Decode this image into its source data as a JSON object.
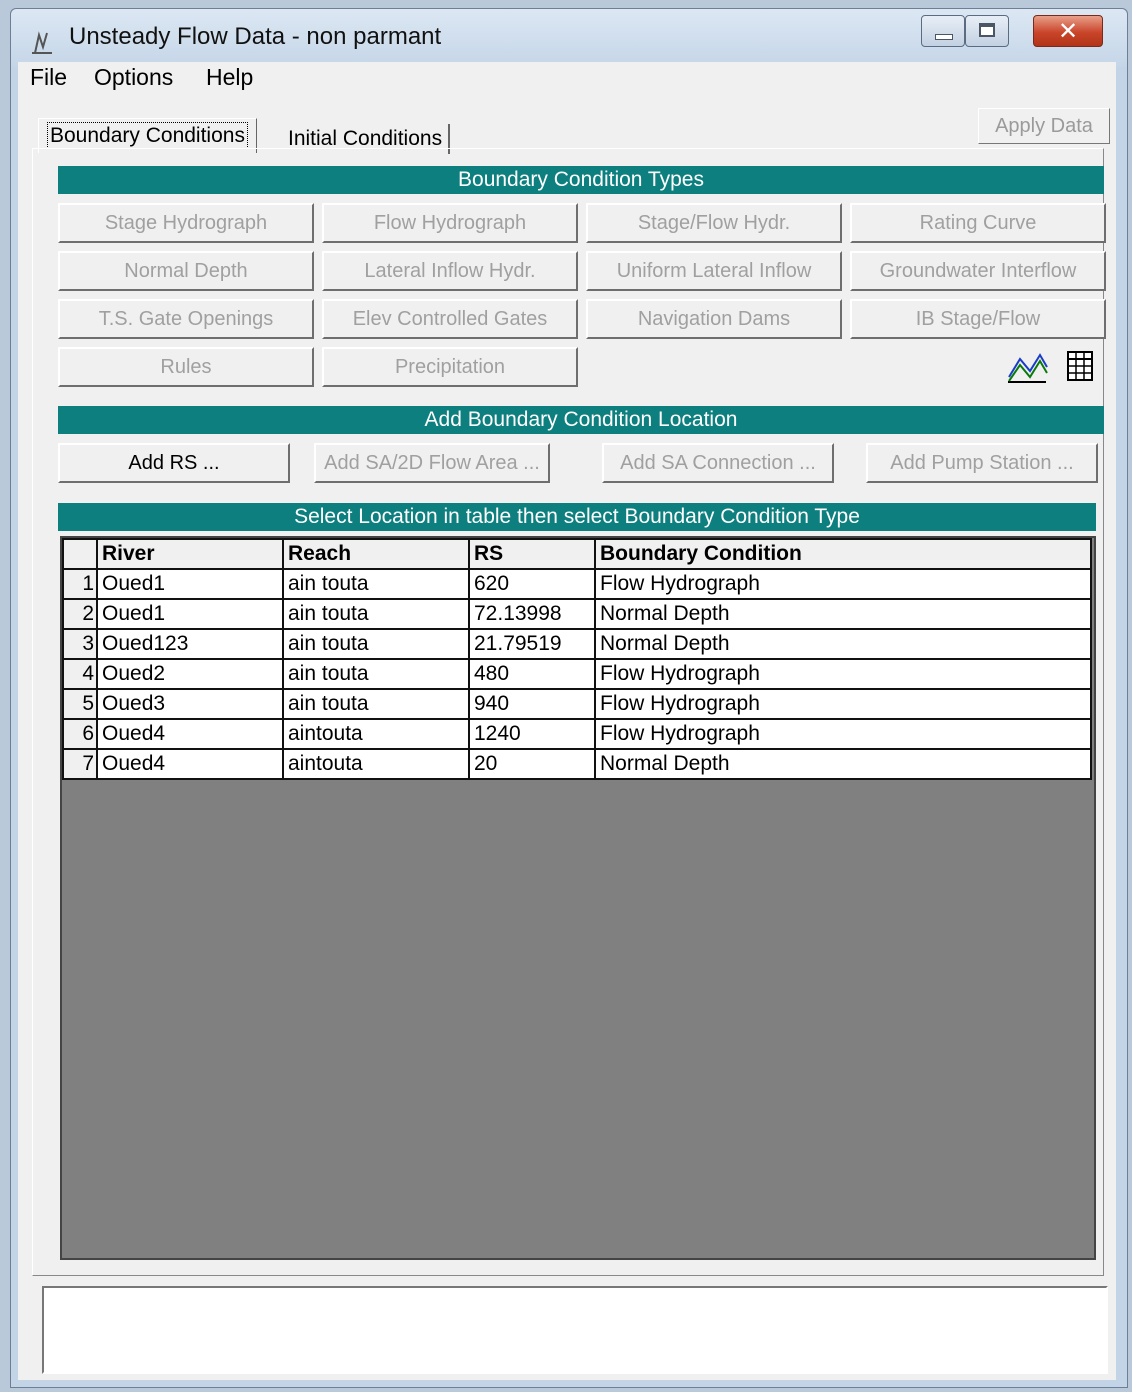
{
  "window": {
    "title": "Unsteady Flow Data - non parmant"
  },
  "menu": {
    "items": [
      "File",
      "Options",
      "Help"
    ]
  },
  "tabs": {
    "boundary": "Boundary Conditions",
    "initial": "Initial Conditions"
  },
  "apply_label": "Apply Data",
  "bc_types": {
    "header": "Boundary Condition Types",
    "buttons": [
      "Stage Hydrograph",
      "Flow Hydrograph",
      "Stage/Flow Hydr.",
      "Rating Curve",
      "Normal Depth",
      "Lateral Inflow Hydr.",
      "Uniform Lateral Inflow",
      "Groundwater Interflow",
      "T.S. Gate Openings",
      "Elev Controlled Gates",
      "Navigation Dams",
      "IB Stage/Flow",
      "Rules",
      "Precipitation"
    ]
  },
  "add_location": {
    "header": "Add Boundary Condition Location",
    "buttons": [
      "Add RS ...",
      "Add SA/2D Flow Area ...",
      "Add SA Connection ...",
      "Add Pump Station ..."
    ]
  },
  "table": {
    "header": "Select Location in table then select Boundary Condition Type",
    "columns": [
      "River",
      "Reach",
      "RS",
      "Boundary Condition"
    ],
    "rows": [
      [
        "1",
        "Oued1",
        "ain touta",
        "620",
        "Flow Hydrograph"
      ],
      [
        "2",
        "Oued1",
        "ain touta",
        "72.13998",
        "Normal Depth"
      ],
      [
        "3",
        "Oued123",
        "ain touta",
        "21.79519",
        "Normal Depth"
      ],
      [
        "4",
        "Oued2",
        "ain touta",
        "480",
        "Flow Hydrograph"
      ],
      [
        "5",
        "Oued3",
        "ain touta",
        "940",
        "Flow Hydrograph"
      ],
      [
        "6",
        "Oued4",
        "aintouta",
        "1240",
        "Flow Hydrograph"
      ],
      [
        "7",
        "Oued4",
        "aintouta",
        "20",
        "Normal Depth"
      ]
    ]
  },
  "colors": {
    "section_header": "#0e7f7f",
    "table_bg": "#808080",
    "disabled_text": "#a0a0a0"
  },
  "icons": [
    "app-icon",
    "minimize-icon",
    "maximize-icon",
    "close-icon",
    "plot-icon",
    "table-icon"
  ]
}
